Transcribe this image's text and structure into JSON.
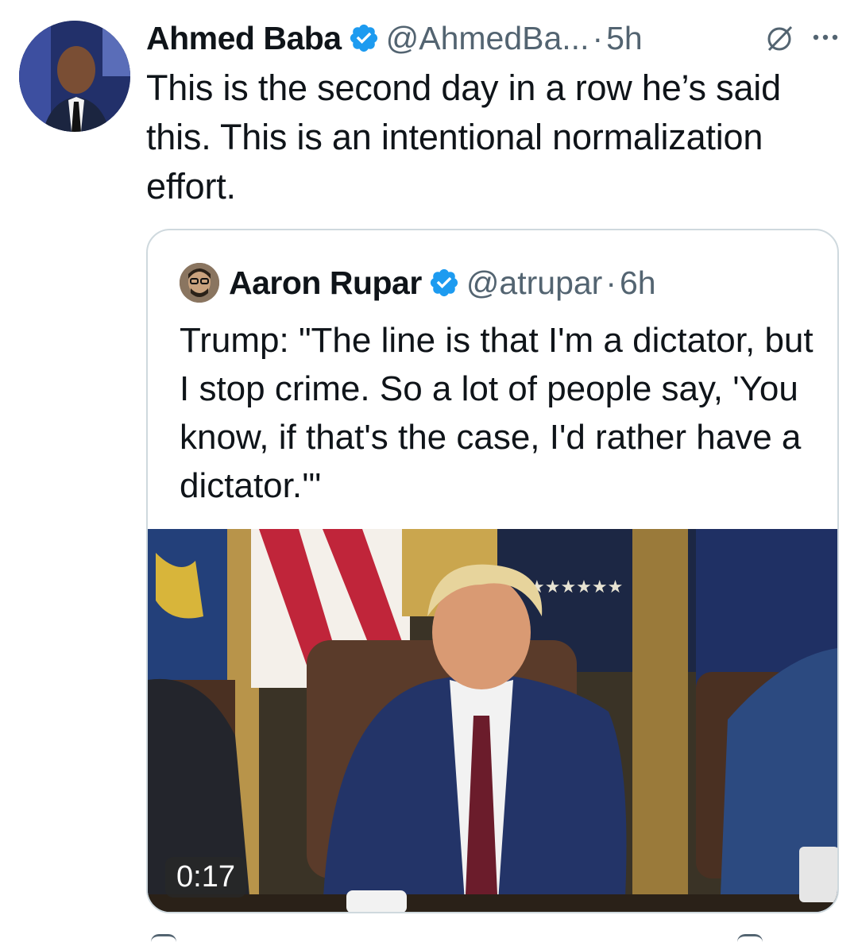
{
  "tweet": {
    "author_name": "Ahmed Baba",
    "handle": "@AhmedBa...",
    "separator": "·",
    "time": "5h",
    "text": "This is the second day in a row he’s said this. This is an intentional normalization effort."
  },
  "quote": {
    "author_name": "Aaron Rupar",
    "handle": "@atrupar",
    "separator": "·",
    "time": "6h",
    "text": "Trump: \"The line is that I'm a dictator, but I stop crime. So a lot of people say, 'You know, if that's the case, I'd rather have a dictator.'\"",
    "video_duration": "0:17"
  },
  "colors": {
    "verified": "#1d9bf0",
    "secondary_text": "#536471",
    "border": "#cfd9de"
  },
  "icons": [
    "verified-badge-icon",
    "grok-icon",
    "more-icon",
    "play-media"
  ]
}
